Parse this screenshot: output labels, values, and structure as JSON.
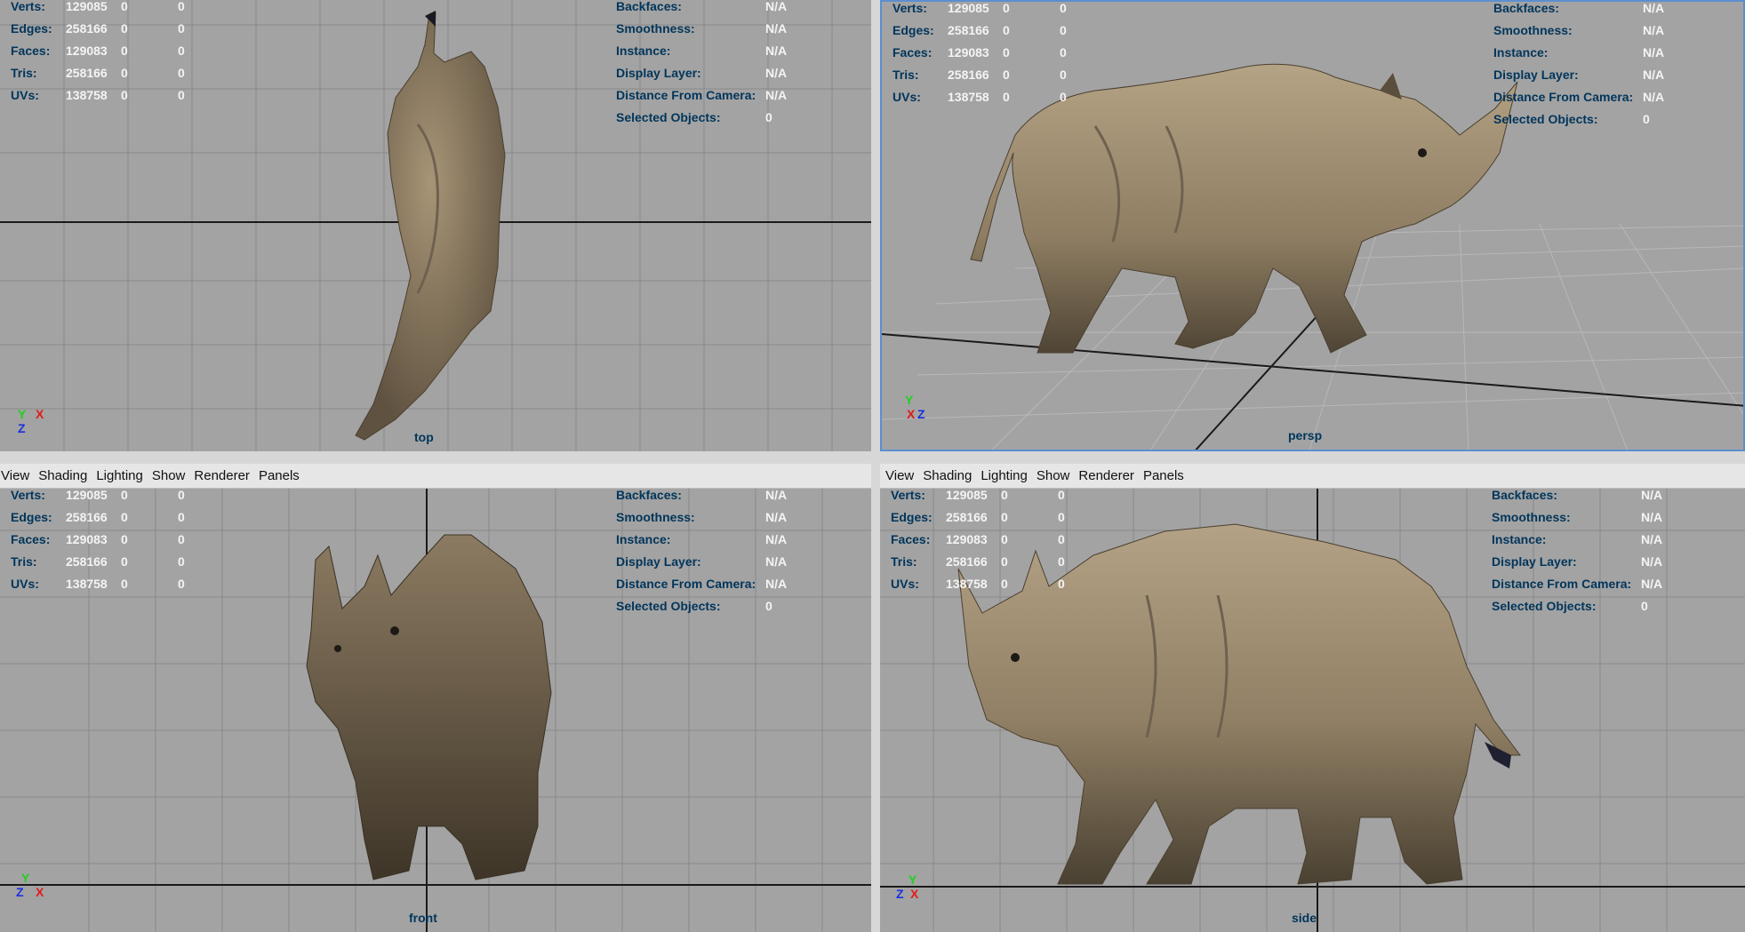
{
  "menu": [
    "View",
    "Shading",
    "Lighting",
    "Show",
    "Renderer",
    "Panels"
  ],
  "hud_left": [
    {
      "label": "Verts:",
      "v1": "129085",
      "v2": "0",
      "v3": "0"
    },
    {
      "label": "Edges:",
      "v1": "258166",
      "v2": "0",
      "v3": "0"
    },
    {
      "label": "Faces:",
      "v1": "129083",
      "v2": "0",
      "v3": "0"
    },
    {
      "label": "Tris:",
      "v1": "258166",
      "v2": "0",
      "v3": "0"
    },
    {
      "label": "UVs:",
      "v1": "138758",
      "v2": "0",
      "v3": "0"
    }
  ],
  "hud_right": [
    {
      "label": "Backfaces:",
      "value": "N/A"
    },
    {
      "label": "Smoothness:",
      "value": "N/A"
    },
    {
      "label": "Instance:",
      "value": "N/A"
    },
    {
      "label": "Display Layer:",
      "value": "N/A"
    },
    {
      "label": "Distance From Camera:",
      "value": "N/A"
    },
    {
      "label": "Selected Objects:",
      "value": "0"
    }
  ],
  "panels": {
    "top": {
      "camera": "top",
      "axis": [
        "Y",
        "X",
        "Z"
      ]
    },
    "persp": {
      "camera": "persp",
      "axis": [
        "Y",
        "X",
        "Z"
      ]
    },
    "front": {
      "camera": "front",
      "axis": [
        "Y",
        "Z",
        "X"
      ]
    },
    "side": {
      "camera": "side",
      "axis": [
        "Y",
        "Z",
        "X"
      ]
    }
  },
  "colors": {
    "viewport_bg": "#a3a3a3",
    "hud_label": "#00355b",
    "hud_value": "#f4f4f4",
    "axis_x": "#e01b1b",
    "axis_y": "#1fcf1f",
    "axis_z": "#1b2fe0"
  }
}
